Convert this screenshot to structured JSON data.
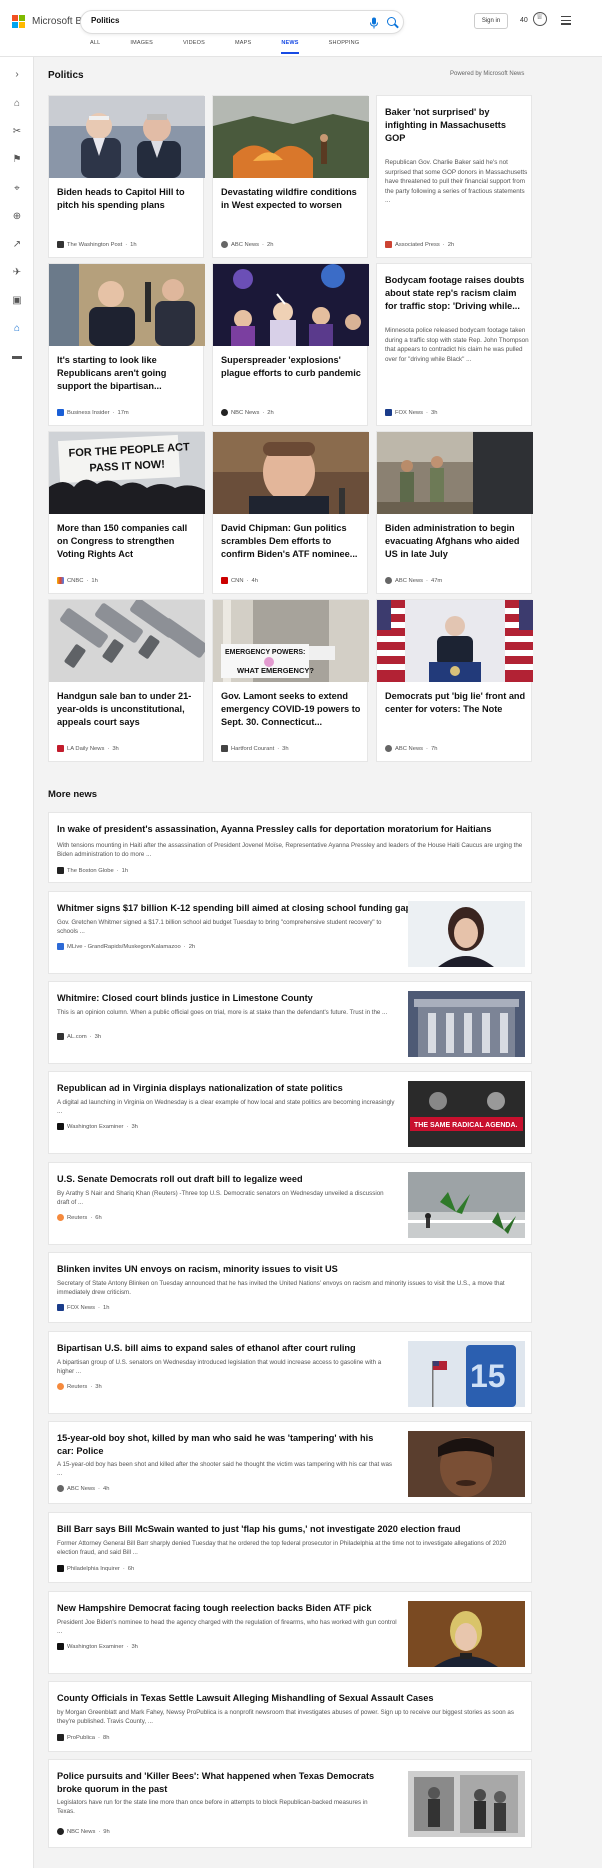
{
  "header": {
    "brand": "Microsoft Bing",
    "search_value": "Politics",
    "signin_label": "Sign in",
    "rewards_count": "40",
    "tabs": [
      {
        "label": "ALL"
      },
      {
        "label": "IMAGES"
      },
      {
        "label": "VIDEOS"
      },
      {
        "label": "MAPS"
      },
      {
        "label": "NEWS"
      },
      {
        "label": "SHOPPING"
      }
    ],
    "active_tab": "NEWS",
    "logo_colors": [
      "#f25022",
      "#7fba00",
      "#00a4ef",
      "#ffb900"
    ],
    "accent": "#174ae4"
  },
  "sidebar": {
    "icons": [
      "expand-icon",
      "home-icon",
      "sports-icon",
      "us-flag-icon",
      "local-pin-icon",
      "world-icon",
      "finance-icon",
      "science-icon",
      "entertainment-icon",
      "politics-icon",
      "money-icon"
    ],
    "active": "politics-icon"
  },
  "main": {
    "section_title": "Politics",
    "powered_by": "Powered by Microsoft News",
    "cards": [
      {
        "title": "Biden heads to Capitol Hill to pitch his spending plans",
        "source": "The Washington Post",
        "time": "1h",
        "image": "photo-senators"
      },
      {
        "title": "Devastating wildfire conditions in West expected to worsen",
        "source": "ABC News",
        "time": "2h",
        "image": "photo-wildfire"
      },
      {
        "title": "Baker 'not surprised' by infighting in Massachusetts GOP",
        "desc": "Republican Gov. Charlie Baker said he's not surprised that some GOP donors in Massachusetts have threatened to pull their financial support from the party following a series of fractious statements ...",
        "source": "Associated Press",
        "time": "2h"
      },
      {
        "title": "It's starting to look like Republicans aren't going support the bipartisan...",
        "source": "Business Insider",
        "time": "17m",
        "image": "photo-mcconnell"
      },
      {
        "title": "Superspreader 'explosions' plague efforts to curb pandemic",
        "source": "NBC News",
        "time": "2h",
        "image": "photo-crowd"
      },
      {
        "title": "Bodycam footage raises doubts about state rep's racism claim for traffic stop: 'Driving while...",
        "desc": "Minnesota police released bodycam footage taken during a traffic stop with state Rep. John Thompson that appears to contradict his claim he was pulled over for \"driving while Black\" ...",
        "source": "FOX News",
        "time": "3h"
      },
      {
        "title": "More than 150 companies call on Congress to strengthen Voting Rights Act",
        "source": "CNBC",
        "time": "1h",
        "image": "photo-protest-sign"
      },
      {
        "title": "David Chipman: Gun politics scrambles Dem efforts to confirm Biden's ATF nominee...",
        "source": "CNN",
        "time": "4h",
        "image": "photo-chipman"
      },
      {
        "title": "Biden administration to begin evacuating Afghans who aided US in late July",
        "source": "ABC News",
        "time": "47m",
        "image": "photo-soldiers"
      },
      {
        "title": "Handgun sale ban to under 21-year-olds is unconstitutional, appeals court says",
        "source": "LA Daily News",
        "time": "3h",
        "image": "photo-handguns"
      },
      {
        "title": "Gov. Lamont seeks to extend emergency COVID-19 powers to Sept. 30. Connecticut...",
        "source": "Hartford Courant",
        "time": "3h",
        "image": "photo-emergency-sign"
      },
      {
        "title": "Democrats put 'big lie' front and center for voters: The Note",
        "source": "ABC News",
        "time": "7h",
        "image": "photo-biden-podium"
      }
    ],
    "emergency_sign_lines": [
      "EMERGENCY POWERS:",
      "WHAT EMERGENCY?"
    ],
    "protest_sign_lines": [
      "FOR THE PEOPLE ACT",
      "PASS IT NOW!"
    ]
  },
  "more_news": {
    "title": "More news",
    "items": [
      {
        "title": "In wake of president's assassination, Ayanna Pressley calls for deportation moratorium for Haitians",
        "desc": "With tensions mounting in Haiti after the assassination of President Jovenel Moïse, Representative Ayanna Pressley and leaders of the House Haiti Caucus are urging the Biden administration to do more ...",
        "source": "The Boston Globe",
        "time": "1h"
      },
      {
        "title": "Whitmer signs $17 billion K-12 spending bill aimed at closing school funding gap",
        "desc": "Gov. Gretchen Whitmer signed a $17.1 billion school aid budget Tuesday to bring \"comprehensive student recovery\" to schools ...",
        "source": "MLive - GrandRapids/Muskegon/Kalamazoo",
        "time": "2h",
        "image": "photo-whitmer"
      },
      {
        "title": "Whitmire: Closed court blinds justice in Limestone County",
        "desc": "This is an opinion column. When a public official goes on trial, more is at stake than the defendant's future. Trust in the ...",
        "source": "AL.com",
        "time": "3h",
        "image": "photo-courthouse"
      },
      {
        "title": "Republican ad in Virginia displays nationalization of state politics",
        "desc": "A digital ad launching in Virginia on Wednesday is a clear example of how local and state politics are becoming increasingly ...",
        "source": "Washington Examiner",
        "time": "3h",
        "image": "photo-radical-agenda",
        "image_text": "THE SAME RADICAL AGENDA."
      },
      {
        "title": "U.S. Senate Democrats roll out draft bill to legalize weed",
        "desc": "By Arathy S Nair and Shariq Khan (Reuters) -Three top U.S. Democratic senators on Wednesday unveiled a discussion draft of ...",
        "source": "Reuters",
        "time": "6h",
        "image": "photo-cannabis"
      },
      {
        "title": "Blinken invites UN envoys on racism, minority issues to visit US",
        "desc": "Secretary of State Antony Blinken on Tuesday announced that he has invited the United Nations' envoys on racism and minority issues to visit the U.S., a move that immediately drew criticism.",
        "source": "FOX News",
        "time": "1h"
      },
      {
        "title": "Bipartisan U.S. bill aims to expand sales of ethanol after court ruling",
        "desc": "A bipartisan group of U.S. senators on Wednesday introduced legislation that would increase access to gasoline with a higher ...",
        "source": "Reuters",
        "time": "3h",
        "image": "photo-e15"
      },
      {
        "title": "15-year-old boy shot, killed by man who said he was 'tampering' with his car: Police",
        "desc": "A 15-year-old boy has been shot and killed after the shooter said he thought the victim was tampering with his car that was ...",
        "source": "ABC News",
        "time": "4h",
        "image": "photo-boy"
      },
      {
        "title": "Bill Barr says Bill McSwain wanted to just 'flap his gums,' not investigate 2020 election fraud",
        "desc": "Former Attorney General Bill Barr sharply denied Tuesday that he ordered the top federal prosecutor in Philadelphia at the time not to investigate allegations of 2020 election fraud, and said Bill ...",
        "source": "Philadelphia Inquirer",
        "time": "6h"
      },
      {
        "title": "New Hampshire Democrat facing tough reelection backs Biden ATF pick",
        "desc": "President Joe Biden's nominee to head the agency charged with the regulation of firearms, who has worked with gun control ...",
        "source": "Washington Examiner",
        "time": "3h",
        "image": "photo-senator"
      },
      {
        "title": "County Officials in Texas Settle Lawsuit Alleging Mishandling of Sexual Assault Cases",
        "desc": "by Morgan Greenblatt and Mark Fahey, Newsy ProPublica is a nonprofit newsroom that investigates abuses of power. Sign up to receive our biggest stories as soon as they're published. Travis County, ...",
        "source": "ProPublica",
        "time": "8h"
      },
      {
        "title": "Police pursuits and 'Killer Bees': What happened when Texas Democrats broke quorum in the past",
        "desc": "Legislators have run for the state line more than once before in attempts to block Republican-backed measures in Texas.",
        "source": "NBC News",
        "time": "9h",
        "image": "photo-archive"
      }
    ]
  }
}
